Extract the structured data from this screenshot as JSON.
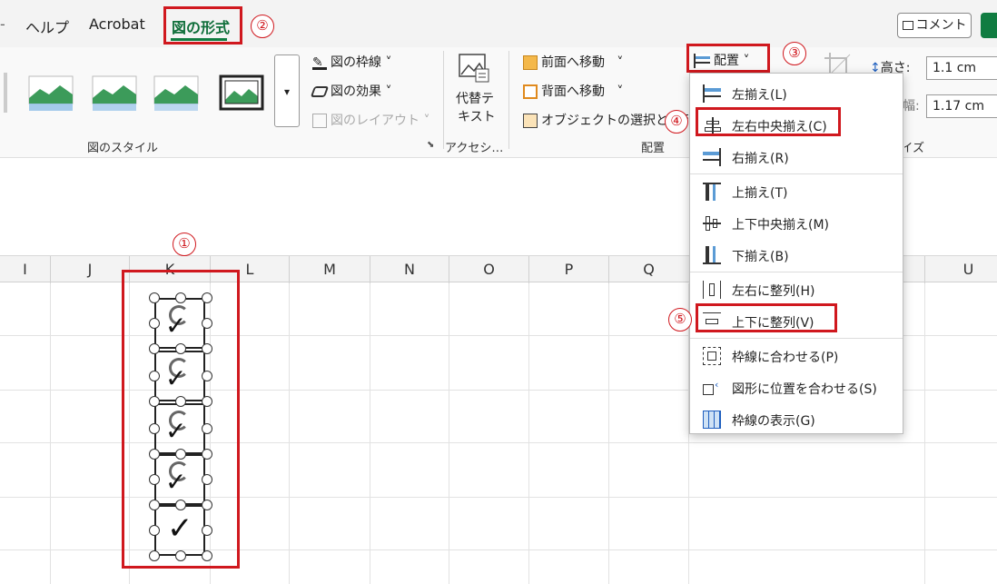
{
  "tabs": {
    "help": "ヘルプ",
    "acrobat": "Acrobat",
    "picture_format": "図の形式"
  },
  "annotations": [
    "①",
    "②",
    "③",
    "④",
    "⑤"
  ],
  "header": {
    "comment": "コメント"
  },
  "ribbon": {
    "picture_border": "図の枠線",
    "picture_effects": "図の効果",
    "picture_layout": "図のレイアウト",
    "styles_group": "図のスタイル",
    "alt_text_line1": "代替テ",
    "alt_text_line2": "キスト",
    "accessibility_group": "アクセシ…",
    "bring_forward": "前面へ移動",
    "send_backward": "背面へ移動",
    "selection_pane": "オブジェクトの選択と表示",
    "arrange_group": "配置",
    "align_button": "配置",
    "height_label": "高さ:",
    "height_value": "1.1 cm",
    "width_label": "幅:",
    "width_value": "1.17 cm",
    "size_group": "サイズ"
  },
  "columns": [
    "I",
    "J",
    "K",
    "L",
    "M",
    "N",
    "O",
    "P",
    "Q",
    "U"
  ],
  "align_menu": {
    "items": [
      "左揃え(L)",
      "左右中央揃え(C)",
      "右揃え(R)",
      "上揃え(T)",
      "上下中央揃え(M)",
      "下揃え(B)",
      "左右に整列(H)",
      "上下に整列(V)",
      "枠線に合わせる(P)",
      "図形に位置を合わせる(S)",
      "枠線の表示(G)"
    ]
  },
  "colors": {
    "accent_green": "#107c41",
    "highlight_red": "#d0181e"
  },
  "icons": [
    "picture-style-icon",
    "border-icon",
    "effects-icon",
    "layout-icon",
    "alt-text-icon",
    "bring-forward-icon",
    "send-backward-icon",
    "selection-pane-icon",
    "align-icon",
    "checkmark-icon",
    "rotate-icon",
    "comment-icon",
    "share-icon"
  ]
}
